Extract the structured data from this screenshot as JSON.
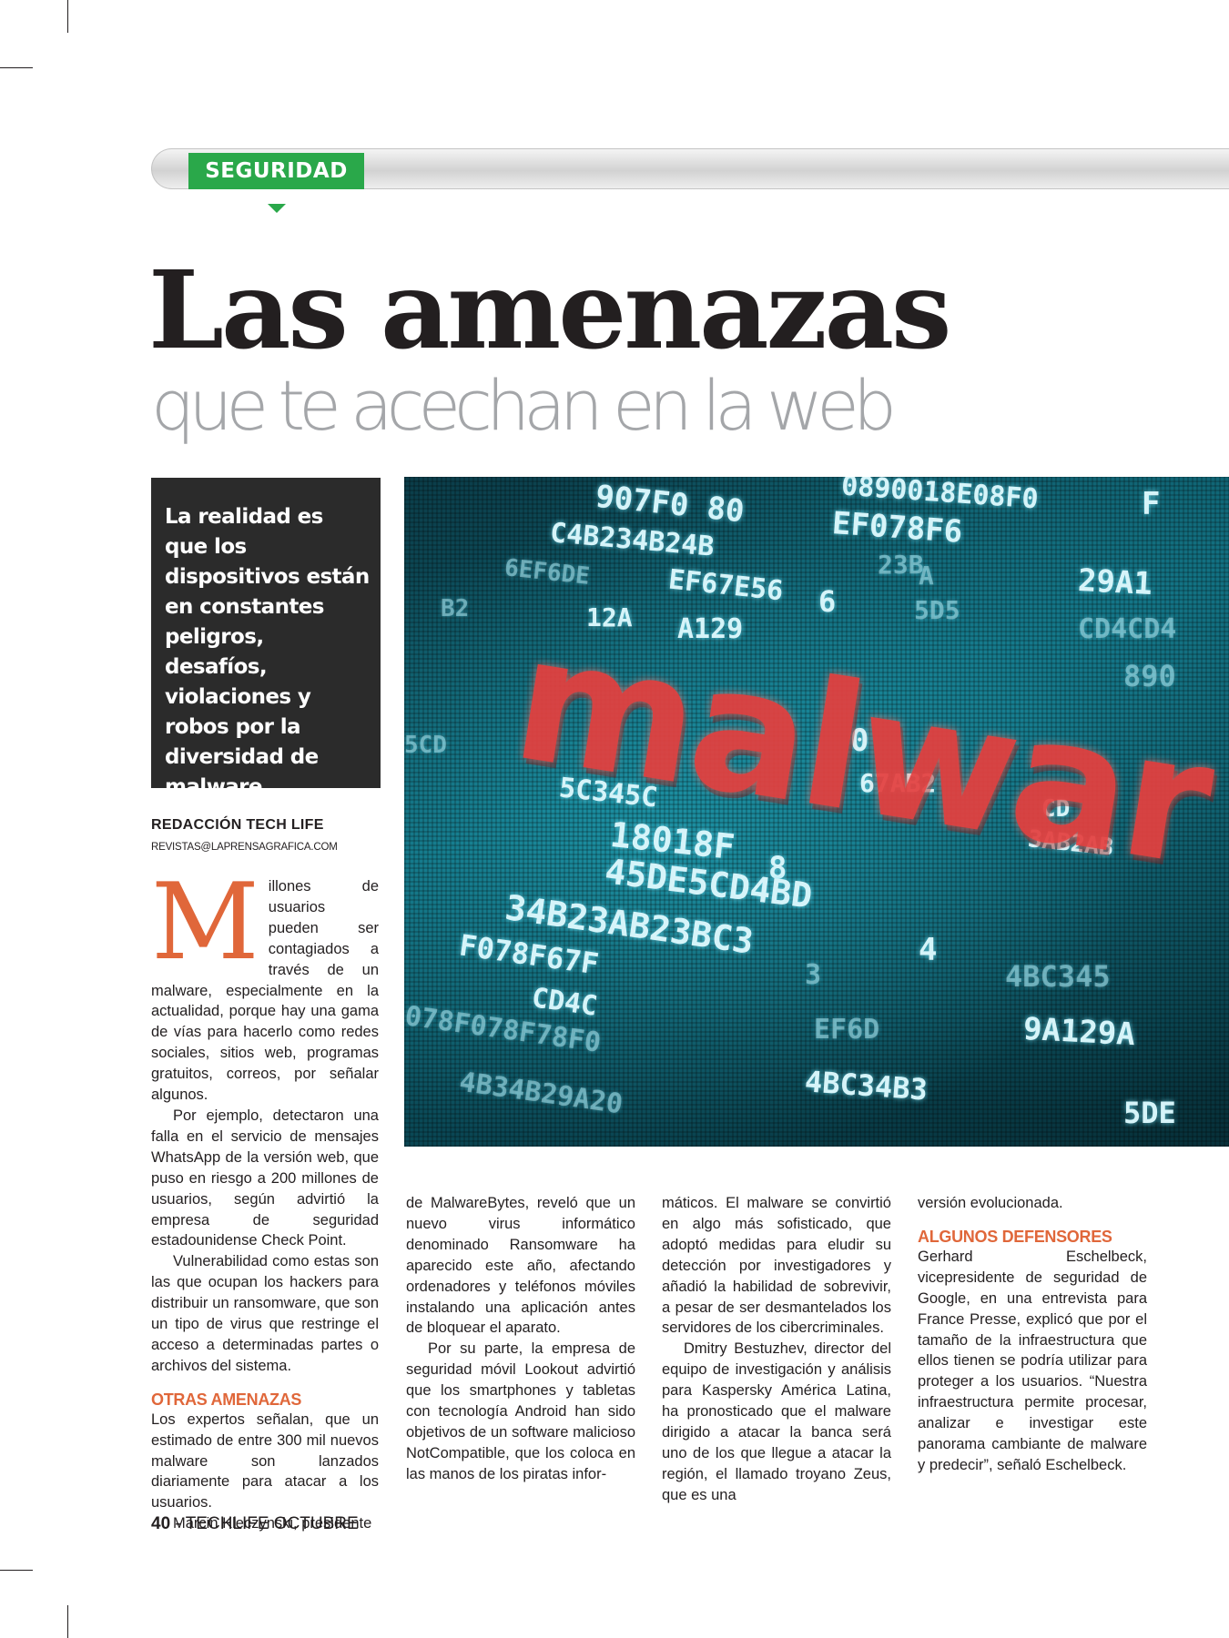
{
  "section": {
    "label": "SEGURIDAD",
    "color": "#2aa84a"
  },
  "headline": {
    "title": "Las amenazas",
    "subtitle": "que te acechan en la web"
  },
  "lead": "La realidad es que los dispositivos están en constantes peligros, desafíos, violaciones y robos por la diversidad de malware.",
  "hero_image": {
    "word": "malwar",
    "hex_strings": [
      "907F0 80",
      "0890018E08F0",
      "F",
      "C4B234B24B",
      "EF078F6",
      "6EF6DE",
      "EF67E56",
      "6",
      "23B",
      "A",
      "29A1",
      "B2",
      "12A",
      "A129",
      "5D5",
      "CD4CD4",
      "890",
      "5CD",
      "5C345C",
      "0",
      "67AB2",
      "CD",
      "3AB2AB",
      "18018F",
      "8",
      "45DE5CD4BD",
      "34B23AB23BC3",
      "4",
      "4BC345",
      "F078F67F",
      "CD4C",
      "3",
      "EF6D",
      "9A129A",
      "078F078F78F0",
      "4BC34B3",
      "4B34B29A20",
      "5DE"
    ]
  },
  "byline": {
    "name": "REDACCIÓN TECH LIFE",
    "email": "REVISTAS@LAPRENSAGRAFICA.COM"
  },
  "body": {
    "dropcap": "M",
    "col1": {
      "p1": "illones de usuarios pueden ser contagiados a través de un malware, especialmente en la actualidad, porque hay una gama de vías para hacerlo como redes sociales, sitios web, programas gratuitos, correos, por señalar algunos.",
      "p2": "Por ejemplo, detectaron una falla en el servicio de mensajes WhatsApp de la versión web, que puso en riesgo a 200 millones de usuarios, según advirtió la empresa de seguridad estadounidense Check Point.",
      "p3": "Vulnerabilidad como estas son las que ocupan los hackers para distribuir un ransomware, que son un tipo de virus que restringe el acceso a determinadas partes o archivos del sistema.",
      "h1": "OTRAS AMENAZAS",
      "p4": "Los expertos señalan, que un estimado de entre 300 mil nuevos malware son lanzados diariamente para atacar a los usuarios.",
      "p5": "Marcin Kleczynski, presidente"
    },
    "col2": {
      "p1": "de MalwareBytes, reveló que un nuevo virus informático denominado Ransomware ha aparecido este año, afectando ordenadores y teléfonos móviles instalando una aplicación antes de bloquear el aparato.",
      "p2": "Por su parte, la empresa de seguridad móvil Lookout advirtió que los smartphones y tabletas con tecnología Android han sido objetivos de un software malicioso NotCompatible, que los coloca en las manos de los piratas infor-"
    },
    "col3": {
      "p1": "máticos. El malware se convirtió en algo más sofisticado, que adoptó medidas para eludir su detección por investigadores y añadió la habilidad de sobrevivir, a pesar de ser desmantelados los servidores de los cibercriminales.",
      "p2": "Dmitry Bestuzhev, director del equipo de investigación y análisis para Kaspersky América Latina, ha pronosticado que el malware dirigido a atacar la banca será uno de los que llegue a atacar la región, el llamado troyano Zeus, que es una"
    },
    "col4": {
      "p1": "versión evolucionada.",
      "h1": "ALGUNOS DEFENSORES",
      "p2": "Gerhard Eschelbeck, vicepresidente de seguridad de Google, en una entrevista para France Presse, explicó que por el tamaño de la infraestructura que ellos tienen se podría utilizar para proteger a los usuarios. “Nuestra infraestructura permite procesar, analizar e investigar este panorama cambiante de malware y predecir”, señaló Eschelbeck."
    }
  },
  "folio": {
    "page": "40",
    "separator": " - ",
    "publication": "TECHLIFE OCTUBRE"
  },
  "colors": {
    "accent": "#e0673a",
    "text": "#231f20",
    "subtitle": "#a4a6a9",
    "lead_bg": "#2b2b2b"
  }
}
